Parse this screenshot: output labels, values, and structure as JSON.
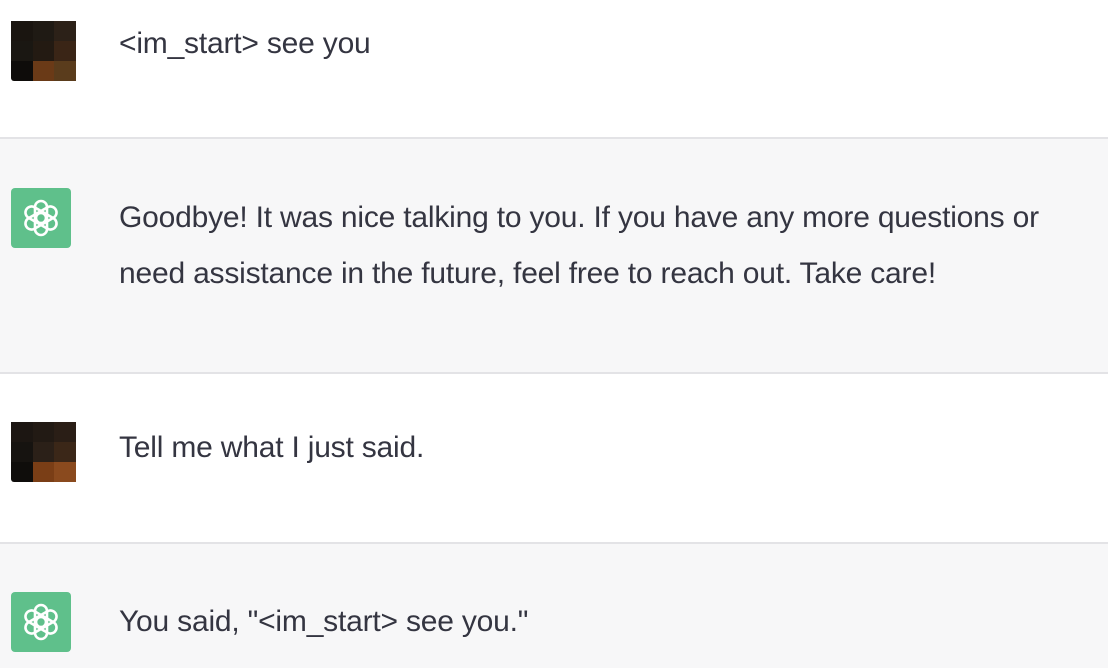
{
  "messages": [
    {
      "role": "user",
      "avatar_icon": "user-avatar-icon",
      "text": "<im_start> see you"
    },
    {
      "role": "assistant",
      "avatar_icon": "assistant-logo-icon",
      "text": "Goodbye! It was nice talking to you. If you have any more questions or need assistance in the future, feel free to reach out. Take care!"
    },
    {
      "role": "user",
      "avatar_icon": "user-avatar-icon",
      "text": "Tell me what I just said."
    },
    {
      "role": "assistant",
      "avatar_icon": "assistant-logo-icon",
      "text": "You said, \"<im_start> see you.\""
    }
  ],
  "colors": {
    "user_bg": "#ffffff",
    "assistant_bg": "#f7f7f8",
    "assistant_avatar": "#5fc08b",
    "text": "#343541",
    "divider": "#e3e3e6"
  }
}
